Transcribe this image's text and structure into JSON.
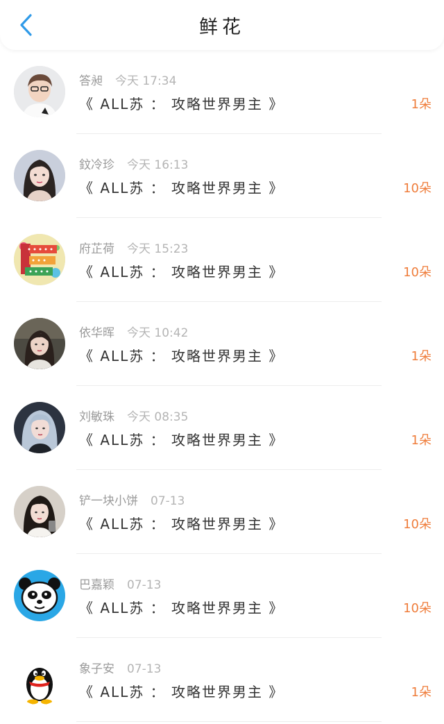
{
  "header": {
    "title": "鲜花"
  },
  "items": [
    {
      "name": "答昶",
      "time": "今天 17:34",
      "book": "《 ALL苏 ： 攻略世界男主 》",
      "count": "1朵",
      "avatar": "boy-photo"
    },
    {
      "name": "鈫冷珍",
      "time": "今天 16:13",
      "book": "《 ALL苏 ： 攻略世界男主 》",
      "count": "10朵",
      "avatar": "girl-illustration"
    },
    {
      "name": "府芷荷",
      "time": "今天 15:23",
      "book": "《 ALL苏 ： 攻略世界男主 》",
      "count": "10朵",
      "avatar": "happy-new-year"
    },
    {
      "name": "依华晖",
      "time": "今天 10:42",
      "book": "《 ALL苏 ： 攻略世界男主 》",
      "count": "1朵",
      "avatar": "girl-photo-dark"
    },
    {
      "name": "刘敏珠",
      "time": "今天 08:35",
      "book": "《 ALL苏 ： 攻略世界男主 》",
      "count": "1朵",
      "avatar": "blue-hair-girl"
    },
    {
      "name": "铲一块小饼",
      "time": "07-13",
      "book": "《 ALL苏 ： 攻略世界男主 》",
      "count": "10朵",
      "avatar": "girl-photo-light"
    },
    {
      "name": "巴嘉颖",
      "time": "07-13",
      "book": "《 ALL苏 ： 攻略世界男主 》",
      "count": "10朵",
      "avatar": "panda"
    },
    {
      "name": "象子安",
      "time": "07-13",
      "book": "《 ALL苏 ： 攻略世界男主 》",
      "count": "1朵",
      "avatar": "qq-penguin"
    }
  ],
  "colors": {
    "accent": "#2f9ae8",
    "count": "#ef7d3b"
  }
}
